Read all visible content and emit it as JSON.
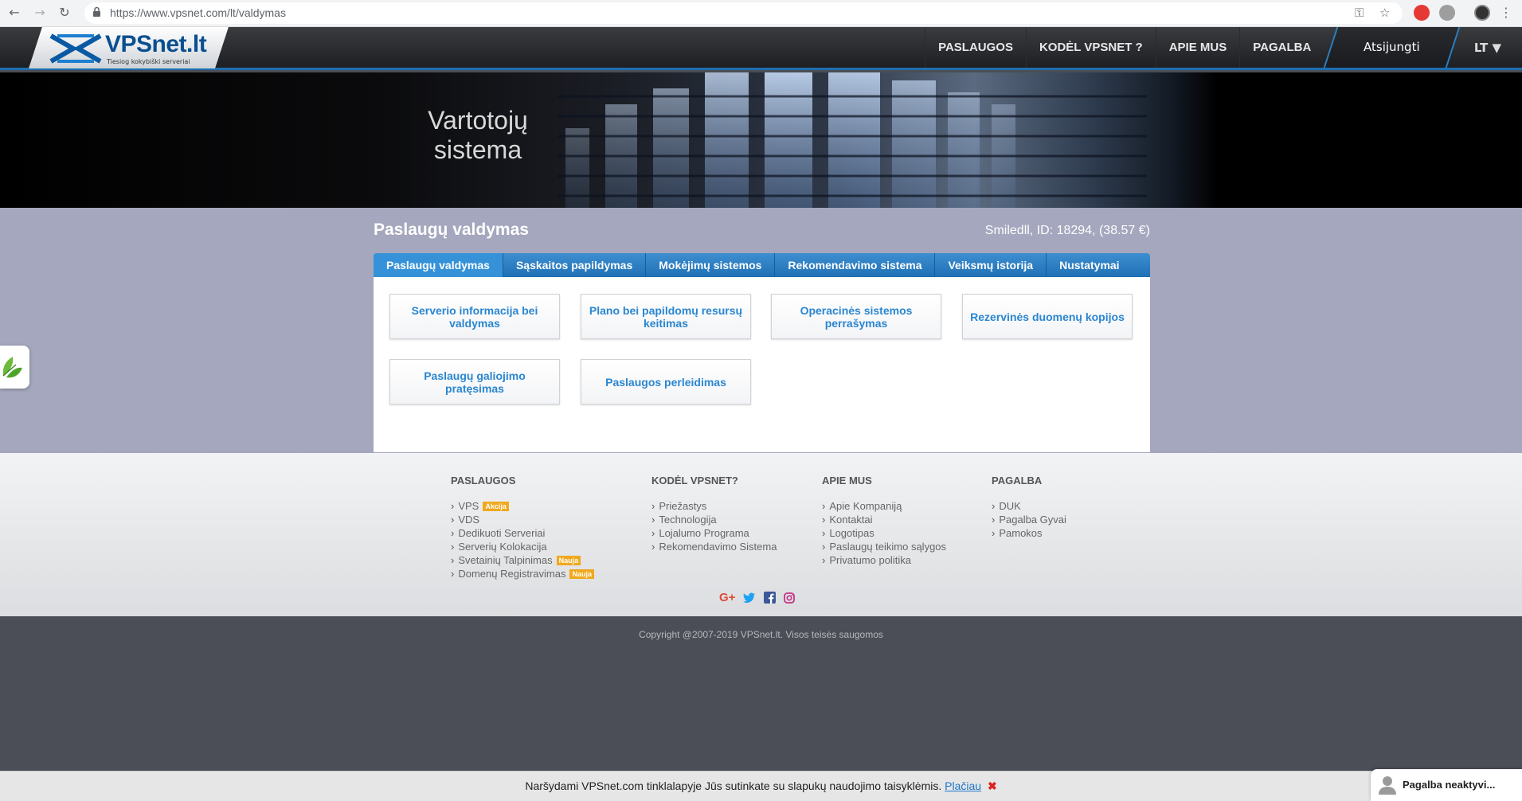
{
  "browser": {
    "url": "https://www.vpsnet.com/lt/valdymas"
  },
  "header": {
    "logo_text": "VPSnet.lt",
    "logo_sub": "Tiesiog kokybiški serveriai",
    "nav": [
      "PASLAUGOS",
      "KODĖL VPSNET ?",
      "APIE MUS",
      "PAGALBA"
    ],
    "logout": "Atsijungti",
    "lang": "LT ▼"
  },
  "banner": {
    "title_line1": "Vartotojų",
    "title_line2": "sistema"
  },
  "main": {
    "page_title": "Paslaugų valdymas",
    "account_info": "Smiledll, ID: 18294, (38.57 €)",
    "tabs": [
      "Paslaugų valdymas",
      "Sąskaitos papildymas",
      "Mokėjimų sistemos",
      "Rekomendavimo sistema",
      "Veiksmų istorija",
      "Nustatymai"
    ],
    "cards": [
      "Serverio informacija bei valdymas",
      "Plano bei papildomų resursų keitimas",
      "Operacinės sistemos perrašymas",
      "Rezervinės duomenų kopijos",
      "Paslaugų galiojimo pratęsimas",
      "Paslaugos perleidimas"
    ]
  },
  "footer": {
    "col1": {
      "title": "PASLAUGOS",
      "links": [
        "VPS",
        "VDS",
        "Dedikuoti Serveriai",
        "Serverių Kolokacija",
        "Svetainių Talpinimas",
        "Domenų Registravimas"
      ],
      "badge_akcija": "Akcija",
      "badge_nauja": "Nauja"
    },
    "col2": {
      "title": "KODĖL VPSNET?",
      "links": [
        "Priežastys",
        "Technologija",
        "Lojalumo Programa",
        "Rekomendavimo Sistema"
      ]
    },
    "col3": {
      "title": "APIE MUS",
      "links": [
        "Apie Kompaniją",
        "Kontaktai",
        "Logotipas",
        "Paslaugų teikimo sąlygos",
        "Privatumo politika"
      ]
    },
    "col4": {
      "title": "PAGALBA",
      "links": [
        "DUK",
        "Pagalba Gyvai",
        "Pamokos"
      ]
    },
    "social": {
      "google": "G+",
      "google_color": "#dd4b39",
      "twitter_color": "#1da1f2",
      "facebook_color": "#3b5998",
      "instagram_color": "#c13584"
    },
    "copyright": "Copyright @2007-2019 VPSnet.lt. Visos teisės saugomos"
  },
  "cookie": {
    "text": "Naršydami VPSnet.com tinklalapyje Jūs sutinkate su slapukų naudojimo taisyklėmis.",
    "link": "Plačiau",
    "close": "✖"
  },
  "chat": {
    "label": "Pagalba neaktyvi..."
  }
}
